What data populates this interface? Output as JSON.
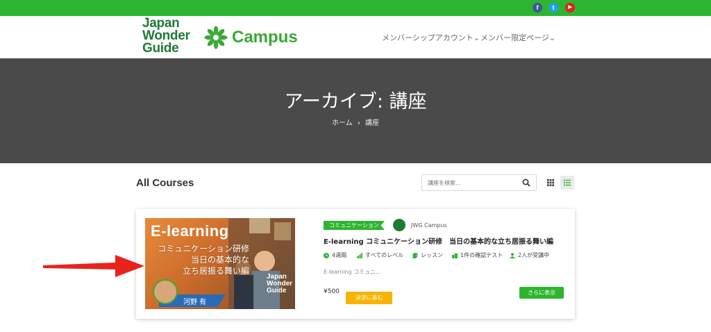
{
  "social": {
    "facebook": "f",
    "twitter": "t",
    "youtube": "▶",
    "colors": {
      "facebook": "#3b5998",
      "twitter": "#1da1f2",
      "youtube": "#e62117"
    }
  },
  "logo": {
    "line1": "Japan",
    "line2": "Wonder",
    "line3": "Guide",
    "campus": "Campus"
  },
  "nav": [
    {
      "label": "メンバーシップアカウント⌄"
    },
    {
      "label": "メンバー限定ページ⌄"
    }
  ],
  "hero": {
    "title": "アーカイブ: 講座",
    "breadcrumb": {
      "home": "ホーム",
      "separator": "›",
      "current": "講座"
    }
  },
  "courses_header": {
    "title": "All Courses",
    "search_placeholder": "講座を検索…"
  },
  "course": {
    "thumbnail": {
      "title": "E-learning",
      "subtitle_lines": [
        "コミュニケーション研修",
        "当日の基本的な",
        "立ち居振る舞い編"
      ],
      "brand": [
        "Japan",
        "Wonder",
        "Guide"
      ],
      "instructor": "河野 有"
    },
    "category": "コミュニケーション",
    "author": "JWG Campus",
    "title": "E-learning コミュニケーション研修　当日の基本的な立ち居振る舞い編",
    "meta": [
      {
        "icon": "clock-icon",
        "text": "4週間"
      },
      {
        "icon": "level-icon",
        "text": "すべてのレベル"
      },
      {
        "icon": "lesson-icon",
        "text": "レッスン"
      },
      {
        "icon": "quiz-icon",
        "text": "1件の確認テスト"
      },
      {
        "icon": "students-icon",
        "text": "2人が受講中"
      }
    ],
    "excerpt": "E-learning コミュニ...",
    "price": "¥500",
    "pay_label": "決済に進む",
    "more_label": "さらに表示"
  },
  "colors": {
    "brand_green": "#2db52f",
    "hero_bg": "#4a4a4a",
    "pay_yellow": "#f6b400",
    "arrow_red": "#e8231d"
  }
}
